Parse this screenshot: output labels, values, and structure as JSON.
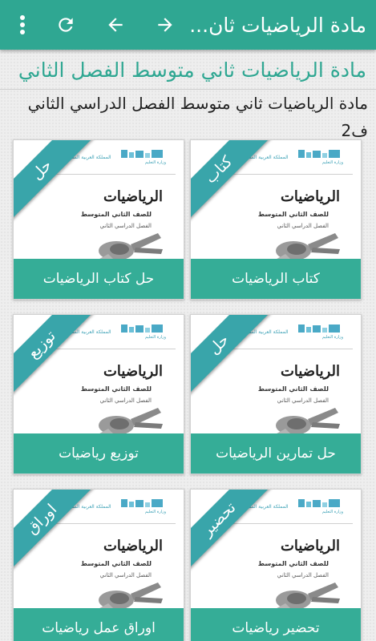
{
  "appbar": {
    "title": "مادة الرياضيات ثان...",
    "icons": {
      "menu": "more-vert-icon",
      "refresh": "refresh-icon",
      "back": "arrow-left-icon",
      "forward": "arrow-right-icon"
    }
  },
  "page": {
    "heading": "مادة الرياضيات ثاني متوسط الفصل الثاني",
    "subheading": "مادة الرياضيات ثاني متوسط الفصل الدراسي الثاني ف2"
  },
  "cover": {
    "kingdom": "المملكة العربية السعودية",
    "ministry": "وزارة التعليم",
    "title": "الرياضيات",
    "grade": "للصف الثاني المتوسط",
    "term": "الفصل الدراسي الثاني"
  },
  "colors": {
    "primary": "#2fa792",
    "label_bg": "#35ad97",
    "ribbon": "#39a5aa"
  },
  "cards": [
    {
      "ribbon": "كتاب",
      "label": "كتاب الرياضيات"
    },
    {
      "ribbon": "حل",
      "label": "حل كتاب الرياضيات"
    },
    {
      "ribbon": "حل",
      "label": "حل تمارين الرياضيات"
    },
    {
      "ribbon": "توزيع",
      "label": "توزيع رياضيات"
    },
    {
      "ribbon": "تحضير",
      "label": "تحضير رياضيات"
    },
    {
      "ribbon": "اوراق",
      "label": "اوراق عمل رياضيات"
    }
  ]
}
